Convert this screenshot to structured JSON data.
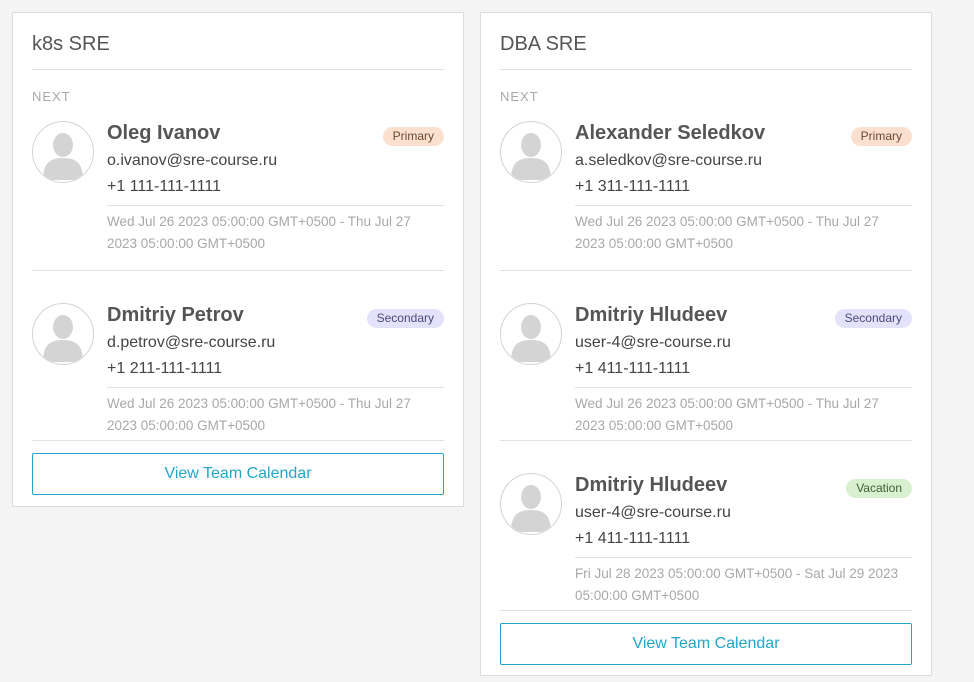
{
  "teams": [
    {
      "title": "k8s SRE",
      "section_label": "NEXT",
      "people": [
        {
          "name": "Oleg Ivanov",
          "email": "o.ivanov@sre-course.ru",
          "phone": "+1 111-111-1111",
          "badge": "Primary",
          "dates": "Wed Jul 26 2023 05:00:00 GMT+0500 - Thu Jul 27 2023 05:00:00 GMT+0500"
        },
        {
          "name": "Dmitriy Petrov",
          "email": "d.petrov@sre-course.ru",
          "phone": "+1 211-111-1111",
          "badge": "Secondary",
          "dates": "Wed Jul 26 2023 05:00:00 GMT+0500 - Thu Jul 27 2023 05:00:00 GMT+0500"
        }
      ],
      "button_label": "View Team Calendar"
    },
    {
      "title": "DBA SRE",
      "section_label": "NEXT",
      "people": [
        {
          "name": "Alexander Seledkov",
          "email": "a.seledkov@sre-course.ru",
          "phone": "+1 311-111-1111",
          "badge": "Primary",
          "dates": "Wed Jul 26 2023 05:00:00 GMT+0500 - Thu Jul 27 2023 05:00:00 GMT+0500"
        },
        {
          "name": "Dmitriy Hludeev",
          "email": "user-4@sre-course.ru",
          "phone": "+1 411-111-1111",
          "badge": "Secondary",
          "dates": "Wed Jul 26 2023 05:00:00 GMT+0500 - Thu Jul 27 2023 05:00:00 GMT+0500"
        },
        {
          "name": "Dmitriy Hludeev",
          "email": "user-4@sre-course.ru",
          "phone": "+1 411-111-1111",
          "badge": "Vacation",
          "dates": "Fri Jul 28 2023 05:00:00 GMT+0500 - Sat Jul 29 2023 05:00:00 GMT+0500"
        }
      ],
      "button_label": "View Team Calendar"
    }
  ],
  "colors": {
    "accent": "#22a5c9",
    "primary_badge": "#fbe0cf",
    "secondary_badge": "#e4e2fb",
    "vacation_badge": "#d8f0cf"
  },
  "icons": {
    "avatar": "user-silhouette-icon"
  }
}
